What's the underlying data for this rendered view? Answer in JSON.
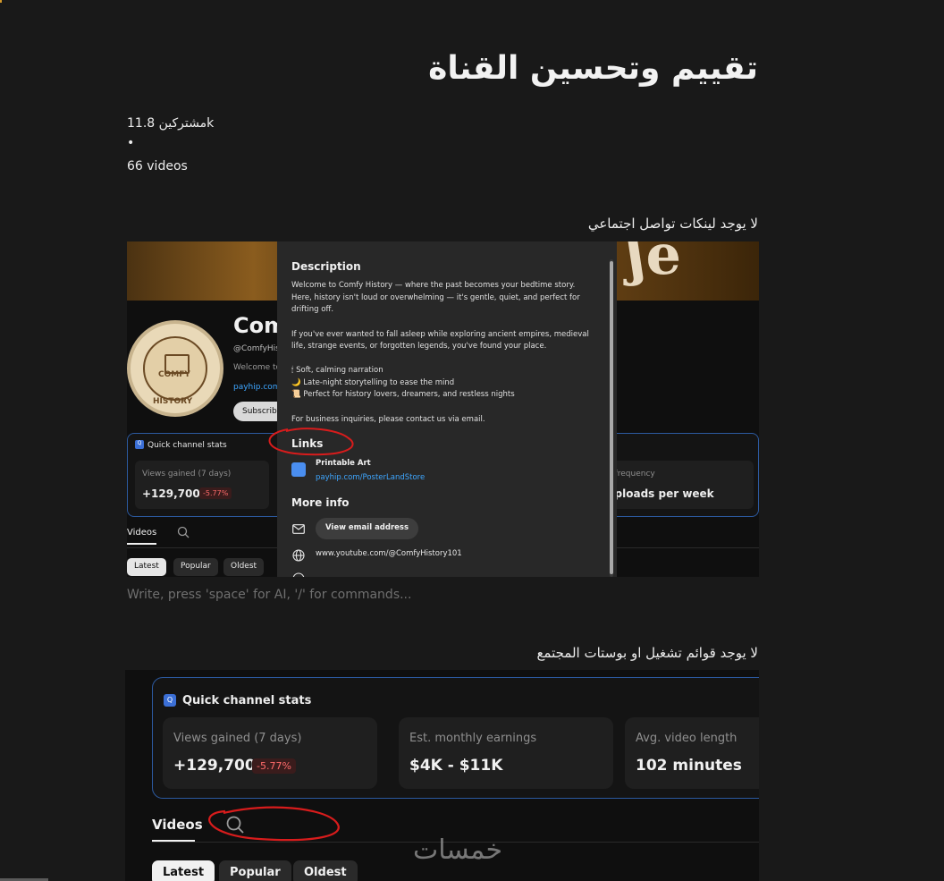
{
  "page": {
    "title": "تقييم وتحسين القناة",
    "subscribers": "مشتركين 11.8k",
    "separator": "•",
    "videos_count": "66 videos",
    "heading_social": "لا يوجد لينكات تواصل اجتماعي",
    "editor_placeholder": "Write, press 'space' for AI, '/' for commands...",
    "heading_playlists": "لا يوجد قوائم تشغيل او بوستات المجتمع",
    "watermark": "خمسات"
  },
  "shot1": {
    "channel_name": "Comf",
    "channel_handle": "@ComfyHis",
    "channel_welcome": "Welcome to",
    "channel_link": "payhip.com",
    "subscribe": "Subscrib",
    "avatar_top": "COMFY",
    "avatar_bottom": "HISTORY",
    "qcs_title": "Quick channel stats",
    "views_label": "Views gained (7 days)",
    "views_value": "+129,700",
    "views_change": "-5.77%",
    "freq_label": "d frequency",
    "freq_value": "uploads per week",
    "tab_videos": "Videos",
    "chips": [
      "Latest",
      "Popular",
      "Oldest"
    ],
    "popup": {
      "description_heading": "Description",
      "description_lines": [
        "Welcome to Comfy History — where the past becomes your bedtime story.",
        "Here, history isn't loud or overwhelming — it's gentle, quiet, and perfect for",
        "drifting off.",
        "If you've ever wanted to fall asleep while exploring ancient empires, medieval",
        "life, strange events, or forgotten legends, you've found your place.",
        "🕯 Soft, calming narration",
        "🌙 Late-night storytelling to ease the mind",
        "📜 Perfect for history lovers, dreamers, and restless nights",
        "For business inquiries, please contact us via email."
      ],
      "links_heading": "Links",
      "link_title": "Printable Art",
      "link_url": "payhip.com/PosterLandStore",
      "more_info_heading": "More info",
      "email_button": "View email address",
      "channel_url": "www.youtube.com/@ComfyHistory101"
    }
  },
  "shot2": {
    "qcs_title": "Quick channel stats",
    "cards": [
      {
        "label": "Views gained (7 days)",
        "value": "+129,700",
        "change": "-5.77%"
      },
      {
        "label": "Est. monthly earnings",
        "value": "$4K - $11K"
      },
      {
        "label": "Avg. video length",
        "value": "102 minutes"
      }
    ],
    "tab_videos": "Videos",
    "chips": [
      "Latest",
      "Popular",
      "Oldest"
    ]
  },
  "colors": {
    "background": "#191919",
    "accent_blue": "#3ea6ff",
    "annotation_red": "#d81c1c",
    "negative_red": "#ff6b6b"
  }
}
